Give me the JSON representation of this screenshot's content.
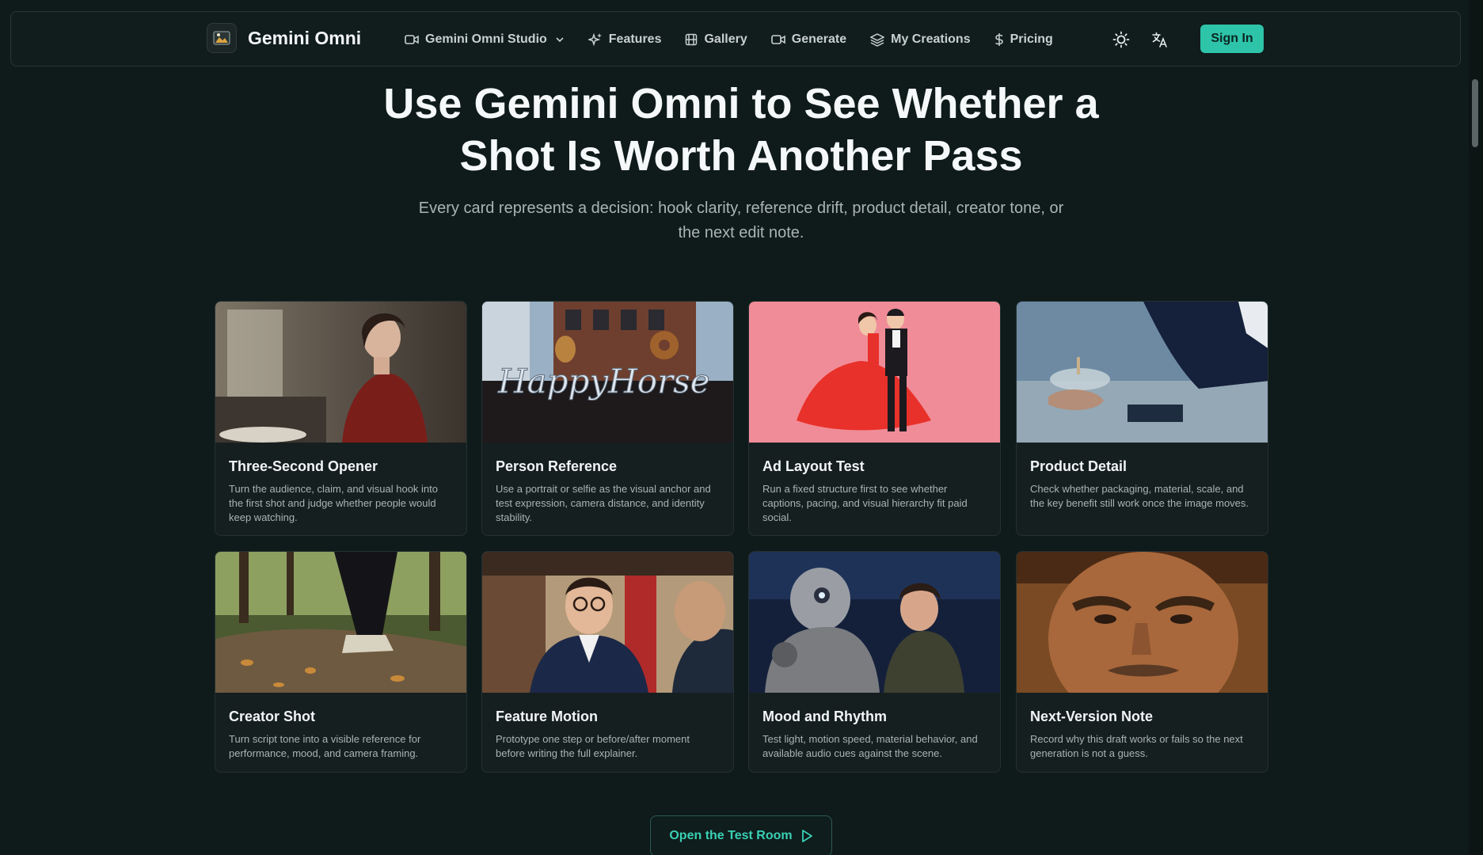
{
  "header": {
    "brand": "Gemini Omni",
    "nav": [
      {
        "label": "Gemini Omni Studio",
        "icon": "video-icon"
      },
      {
        "label": "Features",
        "icon": "sparkles-icon"
      },
      {
        "label": "Gallery",
        "icon": "film-icon"
      },
      {
        "label": "Generate",
        "icon": "video-icon"
      },
      {
        "label": "My Creations",
        "icon": "layers-icon"
      },
      {
        "label": "Pricing",
        "icon": "dollar-icon"
      }
    ],
    "signin_label": "Sign In",
    "accent": "#2ec4aa"
  },
  "hero": {
    "title": "Use Gemini Omni to See Whether a Shot Is Worth Another Pass",
    "subtitle": "Every card represents a decision: hook clarity, reference drift, product detail, creator tone, or the next edit note."
  },
  "cards": [
    {
      "title": "Three-Second Opener",
      "desc": "Turn the audience, claim, and visual hook into the first shot and judge whether people would keep watching."
    },
    {
      "title": "Person Reference",
      "desc": "Use a portrait or selfie as the visual anchor and test expression, camera distance, and identity stability.",
      "image_text": "HappyHorse"
    },
    {
      "title": "Ad Layout Test",
      "desc": "Run a fixed structure first to see whether captions, pacing, and visual hierarchy fit paid social."
    },
    {
      "title": "Product Detail",
      "desc": "Check whether packaging, material, scale, and the key benefit still work once the image moves."
    },
    {
      "title": "Creator Shot",
      "desc": "Turn script tone into a visible reference for performance, mood, and camera framing."
    },
    {
      "title": "Feature Motion",
      "desc": "Prototype one step or before/after moment before writing the full explainer."
    },
    {
      "title": "Mood and Rhythm",
      "desc": "Test light, motion speed, material behavior, and available audio cues against the scene."
    },
    {
      "title": "Next-Version Note",
      "desc": "Record why this draft works or fails so the next generation is not a guess."
    }
  ],
  "cta_label": "Open the Test Room"
}
